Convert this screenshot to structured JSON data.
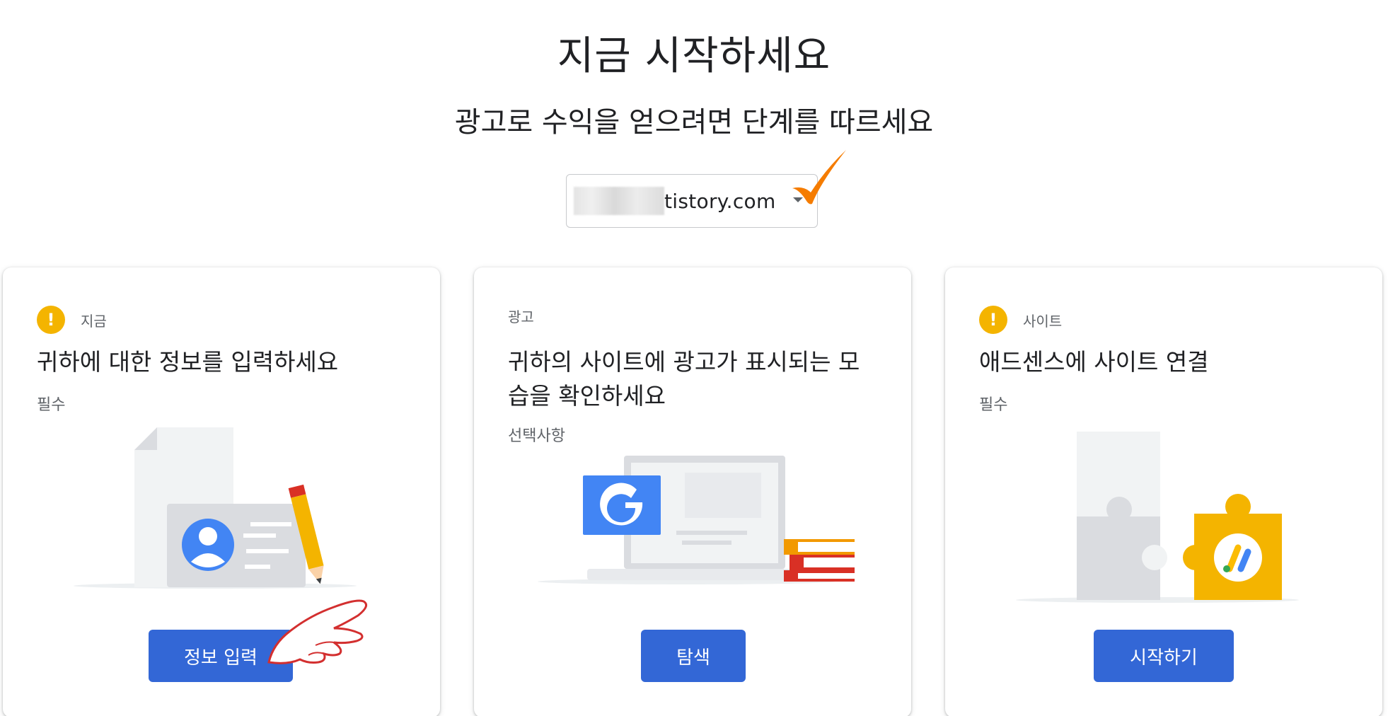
{
  "header": {
    "title": "지금 시작하세요",
    "subtitle": "광고로 수익을 얻으려면 단계를 따르세요"
  },
  "site_selector": {
    "value": "tistory.com",
    "icon": "chevron-down-icon"
  },
  "cards": [
    {
      "status": "지금",
      "status_icon": "warning-icon",
      "title": "귀하에 대한 정보를 입력하세요",
      "note": "필수",
      "button": "정보 입력"
    },
    {
      "status": "광고",
      "title_line1": "귀하의 사이트에 광고가 표시되는 모",
      "title_line2": "습을 확인하세요",
      "note": "선택사항",
      "button": "탐색",
      "illustration_letter": "G"
    },
    {
      "status": "사이트",
      "status_icon": "warning-icon",
      "title": "애드센스에 사이트 연결",
      "note": "필수",
      "button": "시작하기"
    }
  ],
  "colors": {
    "primary": "#3367d6",
    "warning": "#f4b400",
    "annotation_check": "#f57c00",
    "annotation_hand": "#d32f2f"
  }
}
